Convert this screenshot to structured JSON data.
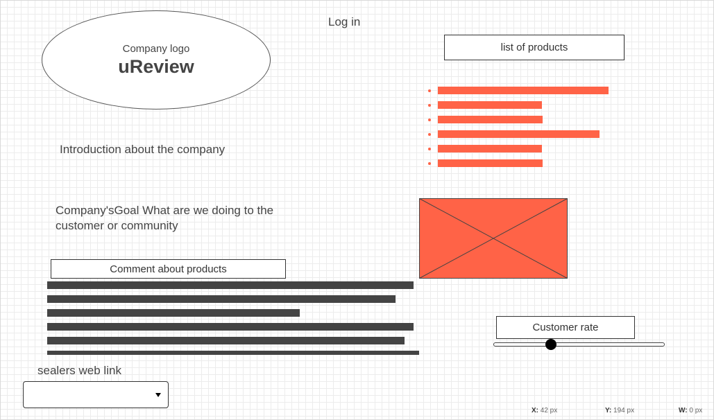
{
  "header": {
    "login_label": "Log in"
  },
  "logo": {
    "subtitle": "Company logo",
    "name": "uReview"
  },
  "products": {
    "label": "list of products",
    "accent_color": "#ff6347",
    "item_count": 6
  },
  "intro_text": "Introduction about the company",
  "goal_text": "Company'sGoal What are we doing to the customer or community",
  "image_placeholder": {
    "icon": "image-placeholder-icon",
    "fill_color": "#ff6347"
  },
  "comments": {
    "label": "Comment about products",
    "line_count": 6
  },
  "rating": {
    "label": "Customer rate",
    "value_fraction": 0.33
  },
  "sellers": {
    "label": "sealers web link",
    "selected": "",
    "icon": "chevron-down-icon"
  },
  "status_bar": {
    "x_label": "X:",
    "x_value": "42 px",
    "y_label": "Y:",
    "y_value": "194 px",
    "w_label": "W:",
    "w_value": "0 px"
  }
}
